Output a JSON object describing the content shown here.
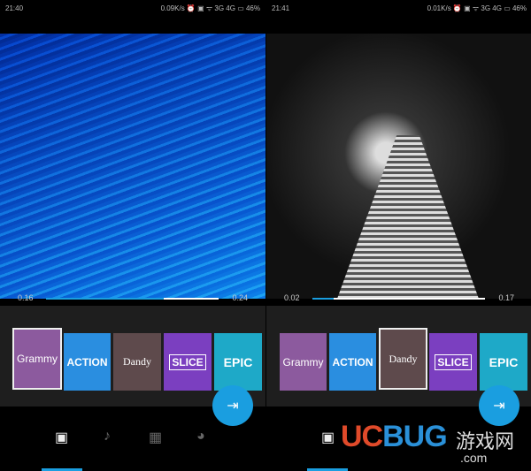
{
  "left": {
    "status": {
      "time": "21:40",
      "right": "0.09K/s ⏰ ▣ ᯤ 3G 4G ▭ 46%"
    },
    "progress": {
      "current": "0.16",
      "total": "0.24",
      "played_fraction": 0.68
    },
    "selected_theme": "Grammy"
  },
  "right": {
    "status": {
      "time": "21:41",
      "right": "0.01K/s ⏰ ▣ ᯤ 3G 4G ▭ 46%"
    },
    "progress": {
      "current": "0.02",
      "total": "0.17",
      "played_fraction": 0.12
    },
    "selected_theme": "Dandy"
  },
  "themes": [
    {
      "label": "Grammy",
      "color": "#8c5a9e"
    },
    {
      "label": "ACTION",
      "color": "#2a8ee0"
    },
    {
      "label": "Dandy",
      "color": "#5e4a4c"
    },
    {
      "label": "SLICE",
      "color": "#7b3fc0"
    },
    {
      "label": "EPIC",
      "color": "#1ea9c8"
    }
  ],
  "nav": {
    "icons": [
      "photo-sparkle-icon",
      "music-note-icon",
      "film-icon",
      "palette-icon"
    ],
    "active": 0
  },
  "fab_icon": "export-icon",
  "accent": "#1a9ee0",
  "watermark": {
    "brand": "UCBUG",
    "suffix": "游戏网",
    ".com": ".com"
  }
}
